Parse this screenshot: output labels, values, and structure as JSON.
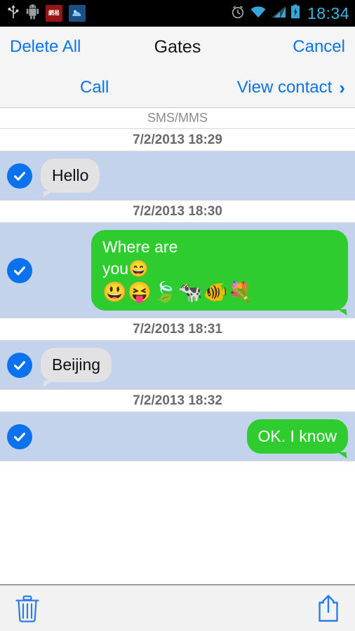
{
  "statusbar": {
    "icons": [
      "usb-icon",
      "android-icon",
      "netease-app-icon",
      "blue-app-icon",
      "alarm-icon",
      "wifi-icon",
      "signal-icon",
      "battery-charging-icon"
    ],
    "netease_label": "網易",
    "blue_app_label": "",
    "time": "18:34"
  },
  "navbar": {
    "delete_all": "Delete All",
    "title": "Gates",
    "cancel": "Cancel",
    "call": "Call",
    "view_contact": "View contact",
    "chevron": "›"
  },
  "thread": {
    "kind_label": "SMS/MMS",
    "groups": [
      {
        "timestamp": "7/2/2013 18:29",
        "direction": "in",
        "selected": true,
        "lines": [
          "Hello"
        ],
        "emojis": ""
      },
      {
        "timestamp": "7/2/2013 18:30",
        "direction": "out",
        "selected": true,
        "lines": [
          "Where are",
          "you😄"
        ],
        "emojis": "😃😝🍃🐄🐠💐"
      },
      {
        "timestamp": "7/2/2013 18:31",
        "direction": "in",
        "selected": true,
        "lines": [
          "Beijing"
        ],
        "emojis": ""
      },
      {
        "timestamp": "7/2/2013 18:32",
        "direction": "out",
        "selected": true,
        "lines": [
          "OK. I know"
        ],
        "emojis": ""
      }
    ]
  },
  "toolbar": {
    "delete_label": "delete-icon",
    "share_label": "share-icon"
  },
  "colors": {
    "accent_blue": "#0a74f0",
    "bubble_out_green": "#2ecc2e",
    "bubble_in_gray": "#e2e2e4",
    "selected_row": "#c3d3eb",
    "status_time": "#36b6e0",
    "chrome_gray": "#f5f5f5"
  }
}
